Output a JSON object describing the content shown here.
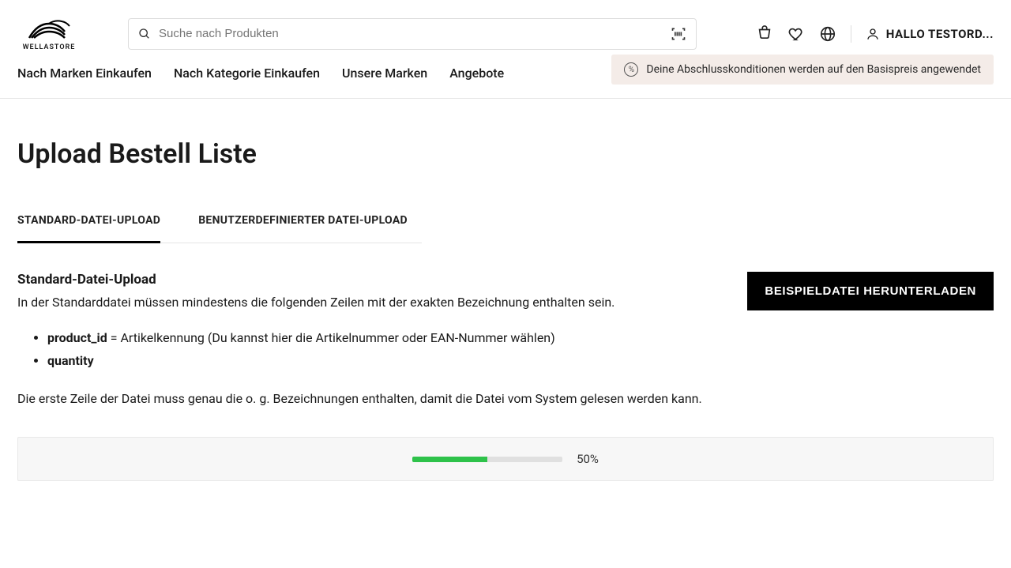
{
  "header": {
    "logo_text": "WELLASTORE",
    "search_placeholder": "Suche nach Produkten",
    "greeting": "HALLO TESTORD..."
  },
  "nav": {
    "items": [
      "Nach Marken Einkaufen",
      "Nach Kategorie Einkaufen",
      "Unsere Marken",
      "Angebote"
    ],
    "banner_text": "Deine Abschlusskonditionen werden auf den Basispreis angewendet",
    "banner_icon": "%"
  },
  "page": {
    "title": "Upload Bestell Liste",
    "tabs": [
      "STANDARD-DATEI-UPLOAD",
      "BENUTZERDEFINIERTER DATEI-UPLOAD"
    ],
    "section_heading": "Standard-Datei-Upload",
    "section_intro": "In der Standarddatei müssen mindestens die folgenden Zeilen mit der exakten Bezeichnung enthalten sein.",
    "bullet1_strong": "product_id",
    "bullet1_rest": " = Artikelkennung (Du kannst hier die Artikelnummer oder EAN-Nummer wählen)",
    "bullet2_strong": "quantity",
    "section_footer": "Die erste Zeile der Datei muss genau die o. g. Bezeichnungen enthalten, damit die Datei vom System gelesen werden kann.",
    "download_button": "BEISPIELDATEI HERUNTERLADEN",
    "progress": {
      "percent": 50,
      "label": "50%"
    }
  }
}
